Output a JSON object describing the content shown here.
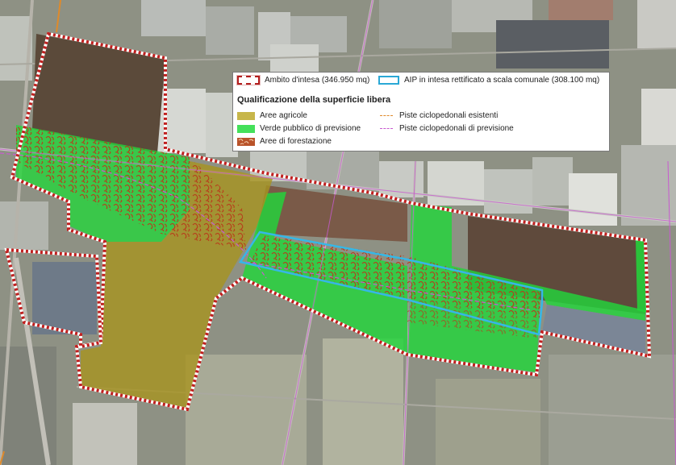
{
  "legend": {
    "ambito": "Ambito d'intesa (346.950 mq)",
    "aip": "AIP in intesa rettificato a scala comunale (308.100 mq)",
    "title": "Qualificazione della superficie libera",
    "aree_agricole": "Aree agricole",
    "verde_pubblico": "Verde pubblico di previsione",
    "aree_forestazione": "Aree di forestazione",
    "piste_esistenti": "Piste ciclopedonali esistenti",
    "piste_previsione": "Piste ciclopedonali di previsione"
  },
  "colors": {
    "ambito_boundary": "#c0201f",
    "aip_boundary": "#36b7e6",
    "aree_agricole": "#b5a32a",
    "verde_pubblico": "#22d63a",
    "aree_forestazione": "#b83a1a",
    "piste_esistenti": "#e08a2a",
    "piste_previsione": "#c85ad0"
  }
}
